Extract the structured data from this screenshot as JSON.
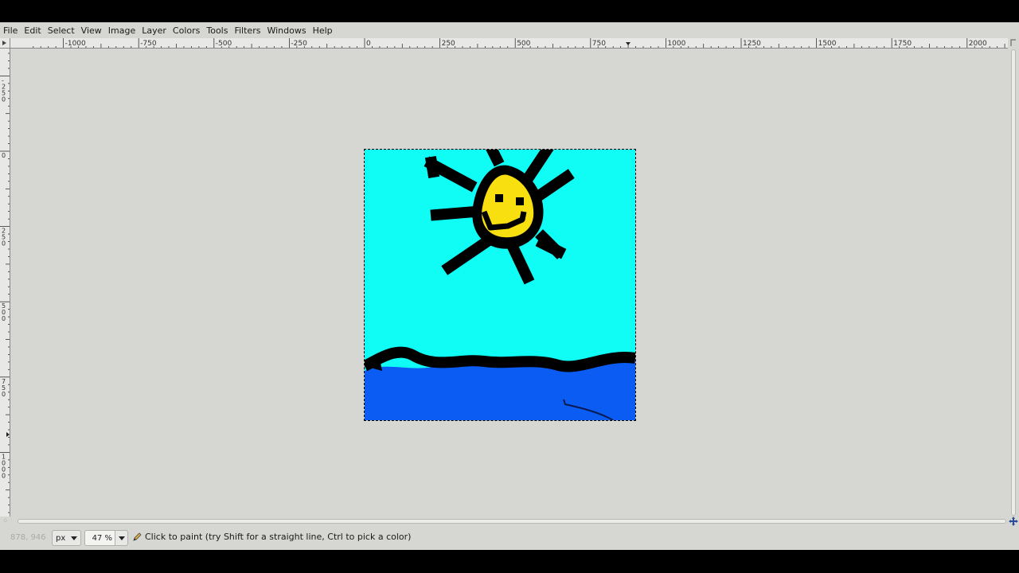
{
  "menubar": {
    "items": [
      "File",
      "Edit",
      "Select",
      "View",
      "Image",
      "Layer",
      "Colors",
      "Tools",
      "Filters",
      "Windows",
      "Help"
    ]
  },
  "rulers": {
    "horizontal_labels": [
      "-1000",
      "-750",
      "-500",
      "-250",
      "0",
      "250",
      "500",
      "750",
      "1000",
      "1250",
      "1500",
      "1750",
      "2000"
    ],
    "vertical_labels": [
      "-250",
      "0",
      "250",
      "500",
      "750",
      "1000"
    ]
  },
  "image": {
    "description_colors": {
      "sky": "#10fdf6",
      "sea": "#0b5cf2",
      "sun_face": "#f8df10",
      "outline": "#000000"
    }
  },
  "statusbar": {
    "coordinates": "878, 946",
    "unit": "px",
    "zoom": "47 %",
    "message": "Click to paint (try Shift for a straight line, Ctrl to pick a color)"
  },
  "icons": {
    "ruler_corner": "ruler-menu-icon",
    "status": "pencil-icon",
    "nav": "navigate-icon"
  }
}
